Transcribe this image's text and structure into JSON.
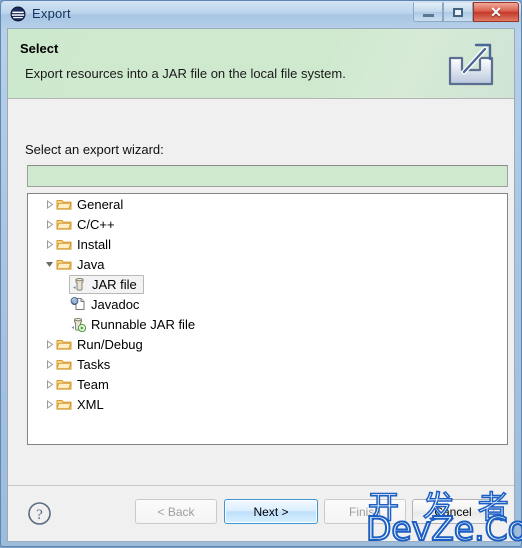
{
  "window": {
    "title": "Export",
    "app_icon": "eclipse-icon",
    "controls": {
      "minimize": "minimize-icon",
      "maximize": "maximize-icon",
      "close": "close-icon"
    }
  },
  "banner": {
    "title": "Select",
    "description": "Export resources into a JAR file on the local file system.",
    "icon": "export-icon",
    "background_color": "#cfe9cf"
  },
  "form": {
    "label": "Select an export wizard:",
    "filter": {
      "value": "",
      "placeholder": ""
    }
  },
  "tree": {
    "nodes": [
      {
        "label": "General",
        "level": 1,
        "expandable": true,
        "expanded": false,
        "icon": "folder-icon",
        "selected": false
      },
      {
        "label": "C/C++",
        "level": 1,
        "expandable": true,
        "expanded": false,
        "icon": "folder-icon",
        "selected": false
      },
      {
        "label": "Install",
        "level": 1,
        "expandable": true,
        "expanded": false,
        "icon": "folder-icon",
        "selected": false
      },
      {
        "label": "Java",
        "level": 1,
        "expandable": true,
        "expanded": true,
        "icon": "folder-icon",
        "selected": false
      },
      {
        "label": "JAR file",
        "level": 2,
        "expandable": false,
        "expanded": false,
        "icon": "jar-file-icon",
        "selected": true
      },
      {
        "label": "Javadoc",
        "level": 2,
        "expandable": false,
        "expanded": false,
        "icon": "javadoc-icon",
        "selected": false
      },
      {
        "label": "Runnable JAR file",
        "level": 2,
        "expandable": false,
        "expanded": false,
        "icon": "runnable-jar-icon",
        "selected": false
      },
      {
        "label": "Run/Debug",
        "level": 1,
        "expandable": true,
        "expanded": false,
        "icon": "folder-icon",
        "selected": false
      },
      {
        "label": "Tasks",
        "level": 1,
        "expandable": true,
        "expanded": false,
        "icon": "folder-icon",
        "selected": false
      },
      {
        "label": "Team",
        "level": 1,
        "expandable": true,
        "expanded": false,
        "icon": "folder-icon",
        "selected": false
      },
      {
        "label": "XML",
        "level": 1,
        "expandable": true,
        "expanded": false,
        "icon": "folder-icon",
        "selected": false
      }
    ]
  },
  "buttons": {
    "help": "help-icon",
    "back": {
      "label": "< Back",
      "enabled": false
    },
    "next": {
      "label": "Next >",
      "enabled": true,
      "is_default": true
    },
    "finish": {
      "label": "Finish",
      "enabled": false
    },
    "cancel": {
      "label": "Cancel",
      "enabled": true
    }
  },
  "watermark": {
    "cjk": "开 发 者",
    "site": "DevZe.CoM",
    "color": "#1b5fc4"
  }
}
